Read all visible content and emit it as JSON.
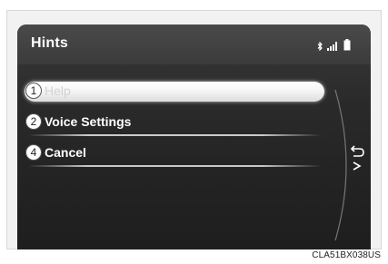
{
  "screen": {
    "title": "Hints"
  },
  "status": {
    "icons": [
      "bluetooth-icon",
      "signal-strength-icon",
      "battery-icon"
    ]
  },
  "menu": {
    "items": [
      {
        "number": "1",
        "label": "Help",
        "state": "highlighted"
      },
      {
        "number": "2",
        "label": "Voice Settings",
        "state": "normal"
      },
      {
        "number": "4",
        "label": "Cancel",
        "state": "normal"
      }
    ]
  },
  "back_button": {
    "icon": "back-arrow-icon"
  },
  "caption": "CLA51BX038US",
  "colors": {
    "screen_background": "#2a2a2a",
    "header_background": "#444444",
    "highlight": "#ffffff",
    "text": "#ffffff"
  }
}
